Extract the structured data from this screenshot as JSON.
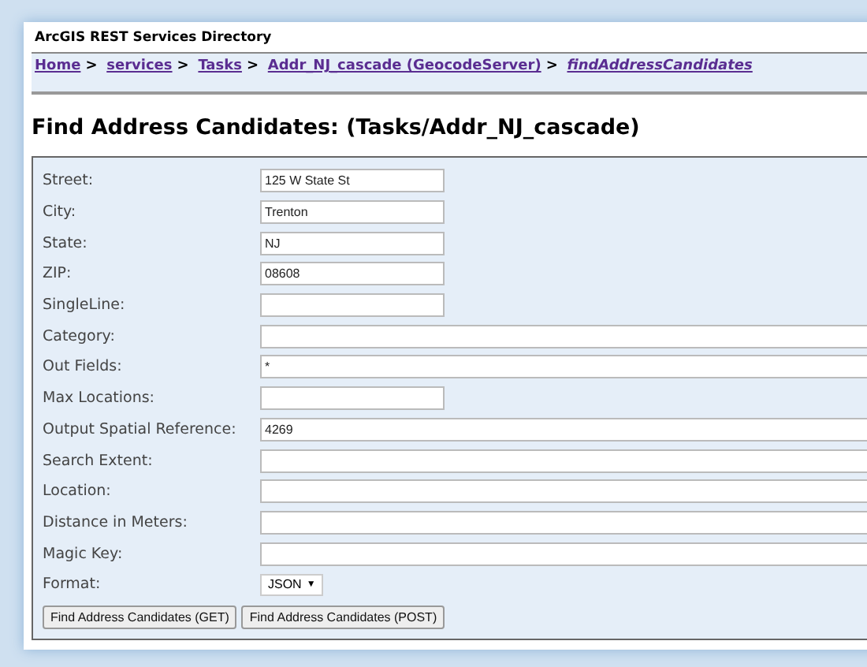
{
  "header": {
    "title": "ArcGIS REST Services Directory"
  },
  "breadcrumb": {
    "separator": ">",
    "items": [
      {
        "label": "Home",
        "current": false
      },
      {
        "label": "services",
        "current": false
      },
      {
        "label": "Tasks",
        "current": false
      },
      {
        "label": "Addr_NJ_cascade (GeocodeServer)",
        "current": false
      },
      {
        "label": "findAddressCandidates",
        "current": true
      }
    ]
  },
  "heading": "Find Address Candidates: (Tasks/Addr_NJ_cascade)",
  "form": {
    "fields": [
      {
        "label": "Street:",
        "kind": "short",
        "value": "125 W State St"
      },
      {
        "label": "City:",
        "kind": "short",
        "value": "Trenton"
      },
      {
        "label": "State:",
        "kind": "short",
        "value": "NJ"
      },
      {
        "label": "ZIP:",
        "kind": "short",
        "value": "08608"
      },
      {
        "label": "SingleLine:",
        "kind": "short"
      },
      {
        "label": "Category:",
        "kind": "long"
      },
      {
        "label": "Out Fields:",
        "kind": "long",
        "value": "*"
      },
      {
        "label": "Max Locations:",
        "kind": "short"
      },
      {
        "label": "Output Spatial Reference:",
        "kind": "long",
        "value": "4269"
      },
      {
        "label": "Search Extent:",
        "kind": "long"
      },
      {
        "label": "Location:",
        "kind": "long"
      },
      {
        "label": "Distance in Meters:",
        "kind": "long"
      },
      {
        "label": "Magic Key:",
        "kind": "long"
      },
      {
        "label": "Format:",
        "kind": "select",
        "value": "JSON",
        "arrow": "▼"
      }
    ],
    "buttons": [
      "Find Address Candidates (GET)",
      "Find Address Candidates (POST)"
    ]
  }
}
